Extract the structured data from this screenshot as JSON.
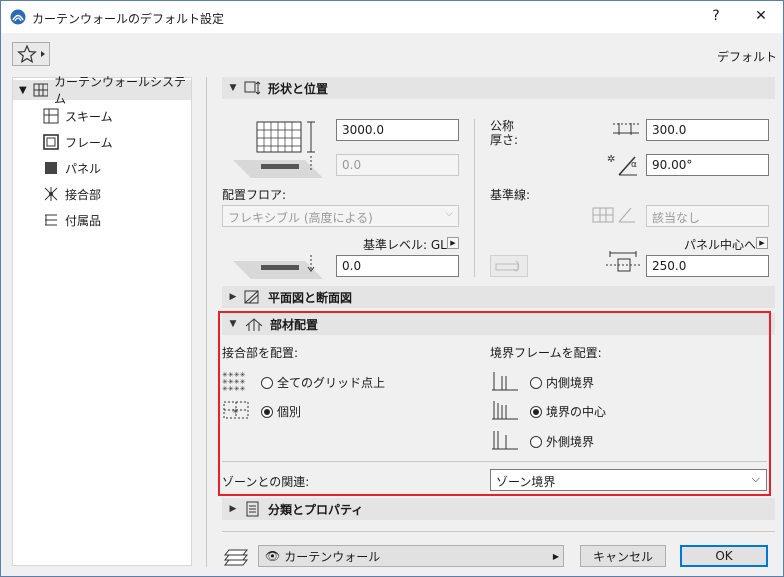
{
  "window": {
    "title": "カーテンウォールのデフォルト設定",
    "help": "?",
    "close": "✕"
  },
  "toolbar": {
    "defaults_label": "デフォルト"
  },
  "tree": {
    "root": "カーテンウォールシステム",
    "items": [
      "スキーム",
      "フレーム",
      "パネル",
      "接合部",
      "付属品"
    ]
  },
  "shape": {
    "section_title": "形状と位置",
    "height_value": "3000.0",
    "offset_value": "0.0",
    "floor_label": "配置フロア:",
    "floor_value": "フレキシブル (高度による)",
    "ref_level_label": "基準レベル: GL",
    "ref_level_value": "0.0",
    "nominal_label_1": "公称",
    "nominal_label_2": "厚さ:",
    "thickness_value": "300.0",
    "angle_value": "90.00°",
    "ref_line_label": "基準線:",
    "ref_line_value": "該当なし",
    "panel_center_label": "パネル中心へ",
    "panel_offset_value": "250.0"
  },
  "plan_section": {
    "title": "平面図と断面図"
  },
  "members": {
    "title": "部材配置",
    "joints_label": "接合部を配置:",
    "joint_options": [
      "全てのグリッド点上",
      "個別"
    ],
    "joint_selected": 1,
    "frames_label": "境界フレームを配置:",
    "frame_options": [
      "内側境界",
      "境界の中心",
      "外側境界"
    ],
    "frame_selected": 1,
    "zone_label": "ゾーンとの関連:",
    "zone_value": "ゾーン境界"
  },
  "classification": {
    "title": "分類とプロパティ"
  },
  "footer": {
    "layer_value": "カーテンウォール",
    "cancel": "キャンセル",
    "ok": "OK"
  },
  "colors": {
    "highlight": "#e8202a",
    "ok_border": "#0078d7",
    "title_border": "#5a7fae"
  }
}
